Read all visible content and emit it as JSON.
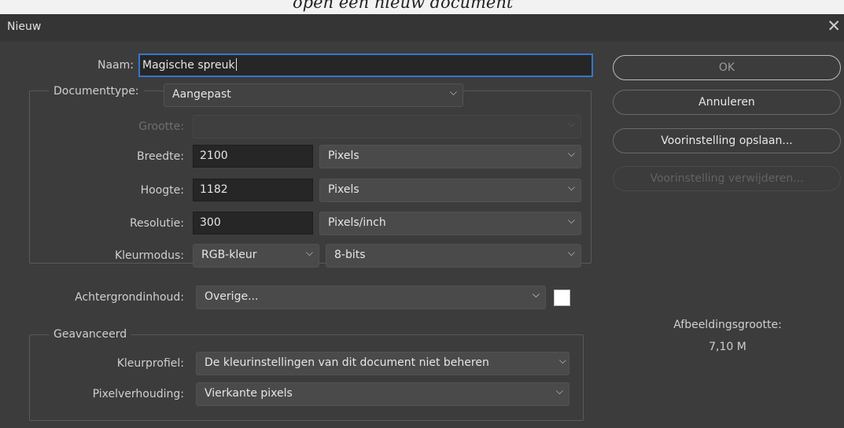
{
  "page_header": {
    "caption": "open een nieuw document"
  },
  "dialog": {
    "title": "Nieuw"
  },
  "fields": {
    "naam": {
      "label": "Naam:",
      "value": "Magische spreuk"
    },
    "documenttype": {
      "label": "Documenttype:",
      "value": "Aangepast"
    },
    "grootte": {
      "label": "Grootte:",
      "value": ""
    },
    "breedte": {
      "label": "Breedte:",
      "value": "2100",
      "unit": "Pixels"
    },
    "hoogte": {
      "label": "Hoogte:",
      "value": "1182",
      "unit": "Pixels"
    },
    "resolutie": {
      "label": "Resolutie:",
      "value": "300",
      "unit": "Pixels/inch"
    },
    "kleurmodus": {
      "label": "Kleurmodus:",
      "mode": "RGB-kleur",
      "bits": "8-bits"
    },
    "achtergrond": {
      "label": "Achtergrondinhoud:",
      "value": "Overige...",
      "swatch_color": "#ffffff"
    }
  },
  "advanced": {
    "legend": "Geavanceerd",
    "kleurprofiel": {
      "label": "Kleurprofiel:",
      "value": "De kleurinstellingen van dit document niet beheren"
    },
    "pixelverhouding": {
      "label": "Pixelverhouding:",
      "value": "Vierkante pixels"
    }
  },
  "buttons": {
    "ok": "OK",
    "cancel": "Annuleren",
    "save_preset": "Voorinstelling opslaan...",
    "delete_preset": "Voorinstelling verwijderen..."
  },
  "image_size": {
    "label": "Afbeeldingsgrootte:",
    "value": "7,10 M"
  },
  "colors": {
    "dialog_bg": "#3c3c3c",
    "field_bg": "#262626",
    "focus_border": "#3577c9",
    "select_bg": "#4a4a4a"
  }
}
